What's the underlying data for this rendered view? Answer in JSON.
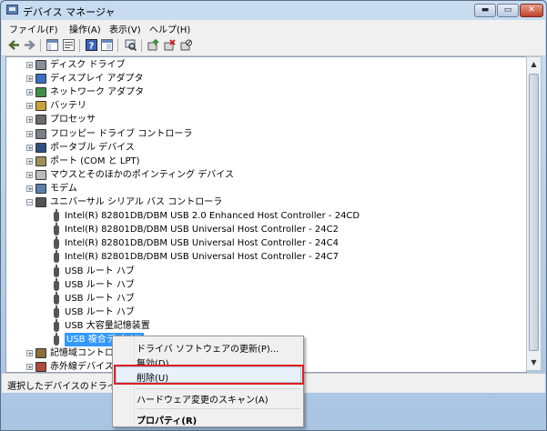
{
  "window": {
    "title": "デバイス マネージャ",
    "min_glyph": "▬",
    "max_glyph": "▭",
    "close_glyph": "✕"
  },
  "menu": [
    "ファイル(F)",
    "操作(A)",
    "表示(V)",
    "ヘルプ(H)"
  ],
  "toolbar": {
    "icons": [
      "back-icon",
      "forward-icon",
      "console-tree-icon",
      "properties-icon",
      "help-icon",
      "view-icon",
      "scan-icon",
      "update-driver-icon",
      "uninstall-icon",
      "disable-icon"
    ]
  },
  "tree": {
    "categories": [
      {
        "label": "ディスク ドライブ",
        "icon": "disk-drive-icon",
        "expand": "+"
      },
      {
        "label": "ディスプレイ アダプタ",
        "icon": "display-adapter-icon",
        "expand": "+"
      },
      {
        "label": "ネットワーク アダプタ",
        "icon": "network-adapter-icon",
        "expand": "+"
      },
      {
        "label": "バッテリ",
        "icon": "battery-icon",
        "expand": "+"
      },
      {
        "label": "プロセッサ",
        "icon": "processor-icon",
        "expand": "+"
      },
      {
        "label": "フロッピー ドライブ コントローラ",
        "icon": "floppy-controller-icon",
        "expand": "+"
      },
      {
        "label": "ポータブル デバイス",
        "icon": "portable-device-icon",
        "expand": "+"
      },
      {
        "label": "ポート (COM と LPT)",
        "icon": "port-icon",
        "expand": "+"
      },
      {
        "label": "マウスとそのほかのポインティング デバイス",
        "icon": "mouse-icon",
        "expand": "+"
      },
      {
        "label": "モデム",
        "icon": "modem-icon",
        "expand": "+"
      },
      {
        "label": "ユニバーサル シリアル バス コントローラ",
        "icon": "usb-controller-icon",
        "expand": "−"
      }
    ],
    "usb_children": [
      "Intel(R) 82801DB/DBM USB 2.0 Enhanced Host Controller - 24CD",
      "Intel(R) 82801DB/DBM USB Universal Host Controller - 24C2",
      "Intel(R) 82801DB/DBM USB Universal Host Controller - 24C4",
      "Intel(R) 82801DB/DBM USB Universal Host Controller - 24C7",
      "USB ルート ハブ",
      "USB ルート ハブ",
      "USB ルート ハブ",
      "USB ルート ハブ",
      "USB 大容量記憶装置",
      "USB 複合デバイス"
    ],
    "after": [
      {
        "label": "記憶域コントロー",
        "icon": "storage-controller-icon",
        "expand": "+"
      },
      {
        "label": "赤外線デバイス",
        "icon": "infrared-device-icon",
        "expand": "+"
      }
    ]
  },
  "status": {
    "text": "選択したデバイスのドライバ"
  },
  "context_menu": {
    "update": "ドライバ ソフトウェアの更新(P)...",
    "disable": "無効(D)",
    "uninstall": "削除(U)",
    "scan": "ハードウェア変更のスキャン(A)",
    "properties": "プロパティ(R)"
  },
  "colors": {
    "selection": "#3399ff",
    "highlight_box": "#e0201a"
  }
}
